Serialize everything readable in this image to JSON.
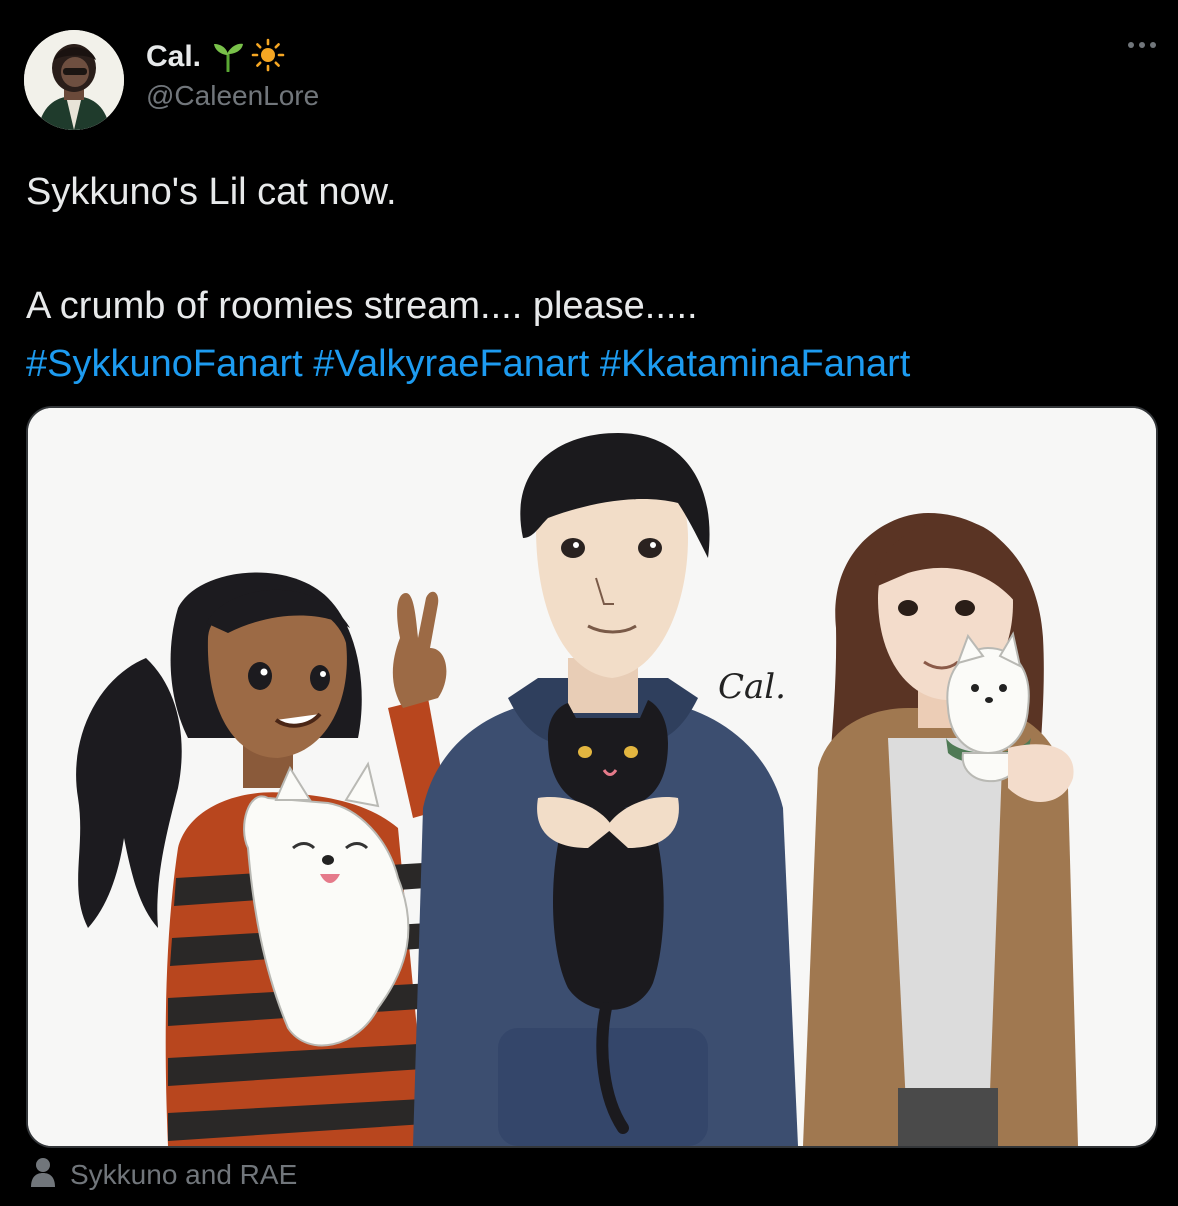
{
  "tweet": {
    "display_name": "Cal.",
    "handle": "@CaleenLore",
    "text_line1": "Sykkuno's Lil cat now.",
    "text_line2": "A crumb of roomies stream.... please.....",
    "hashtags": [
      "#SykkunoFanart",
      "#ValkyraeFanart",
      "#KkataminaFanart"
    ],
    "image_signature": "Cal.",
    "tagged_users": "Sykkuno and RAE"
  },
  "icons": {
    "name_emojis": [
      "seedling-emoji",
      "sun-emoji"
    ],
    "more": "more-options-icon",
    "tagged": "person-icon"
  },
  "colors": {
    "background": "#000000",
    "text": "#e7e9ea",
    "muted": "#71767b",
    "link": "#1d9bf0",
    "border": "#333639"
  }
}
